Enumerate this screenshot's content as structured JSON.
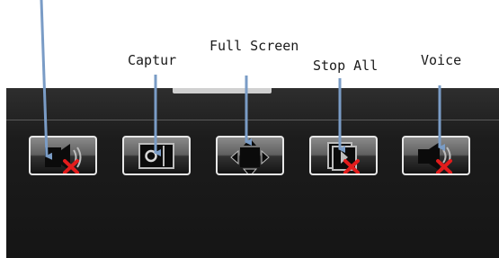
{
  "callouts": {
    "capture": "Captur",
    "full_screen": "Full Screen",
    "stop_all": "Stop All",
    "voice": "Voice"
  },
  "buttons": [
    {
      "name": "talk-mute-button",
      "icon": "speaker-mute-icon"
    },
    {
      "name": "capture-button",
      "icon": "camera-icon"
    },
    {
      "name": "full-screen-button",
      "icon": "four-arrows-icon"
    },
    {
      "name": "stop-all-button",
      "icon": "stop-all-icon"
    },
    {
      "name": "voice-button",
      "icon": "speaker-mute-icon"
    }
  ],
  "colors": {
    "arrow": "#7a9cc6",
    "mute_cross": "#e21c1c",
    "panel": "#1c1c1c"
  }
}
